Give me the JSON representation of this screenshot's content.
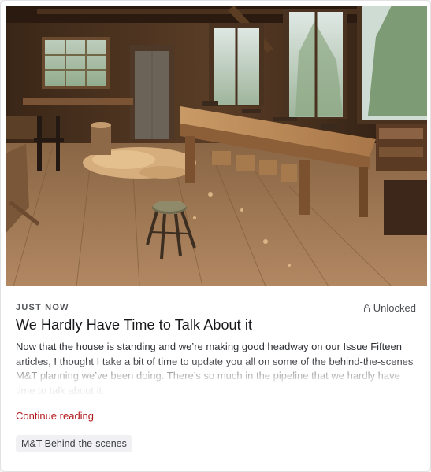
{
  "post": {
    "image_alt": "Woodworking workshop interior with wooden workbench, wood shavings and a stool",
    "timestamp": "JUST NOW",
    "access_label": "Unlocked",
    "title": "We Hardly Have Time to Talk About it",
    "excerpt": "Now that the house is standing and we’re making good headway on our Issue Fifteen articles, I thought I take a bit of time to update you all on some of the behind-the-scenes M&T planning we’ve been doing. There’s so much in the pipeline that we hardly have time to talk about it.",
    "continue_label": "Continue reading",
    "tag": "M&T Behind-the-scenes"
  },
  "icons": {
    "access": "unlock-icon"
  },
  "colors": {
    "link": "#b1161b",
    "tag_bg": "#f1f1f4",
    "text": "#17181b"
  }
}
